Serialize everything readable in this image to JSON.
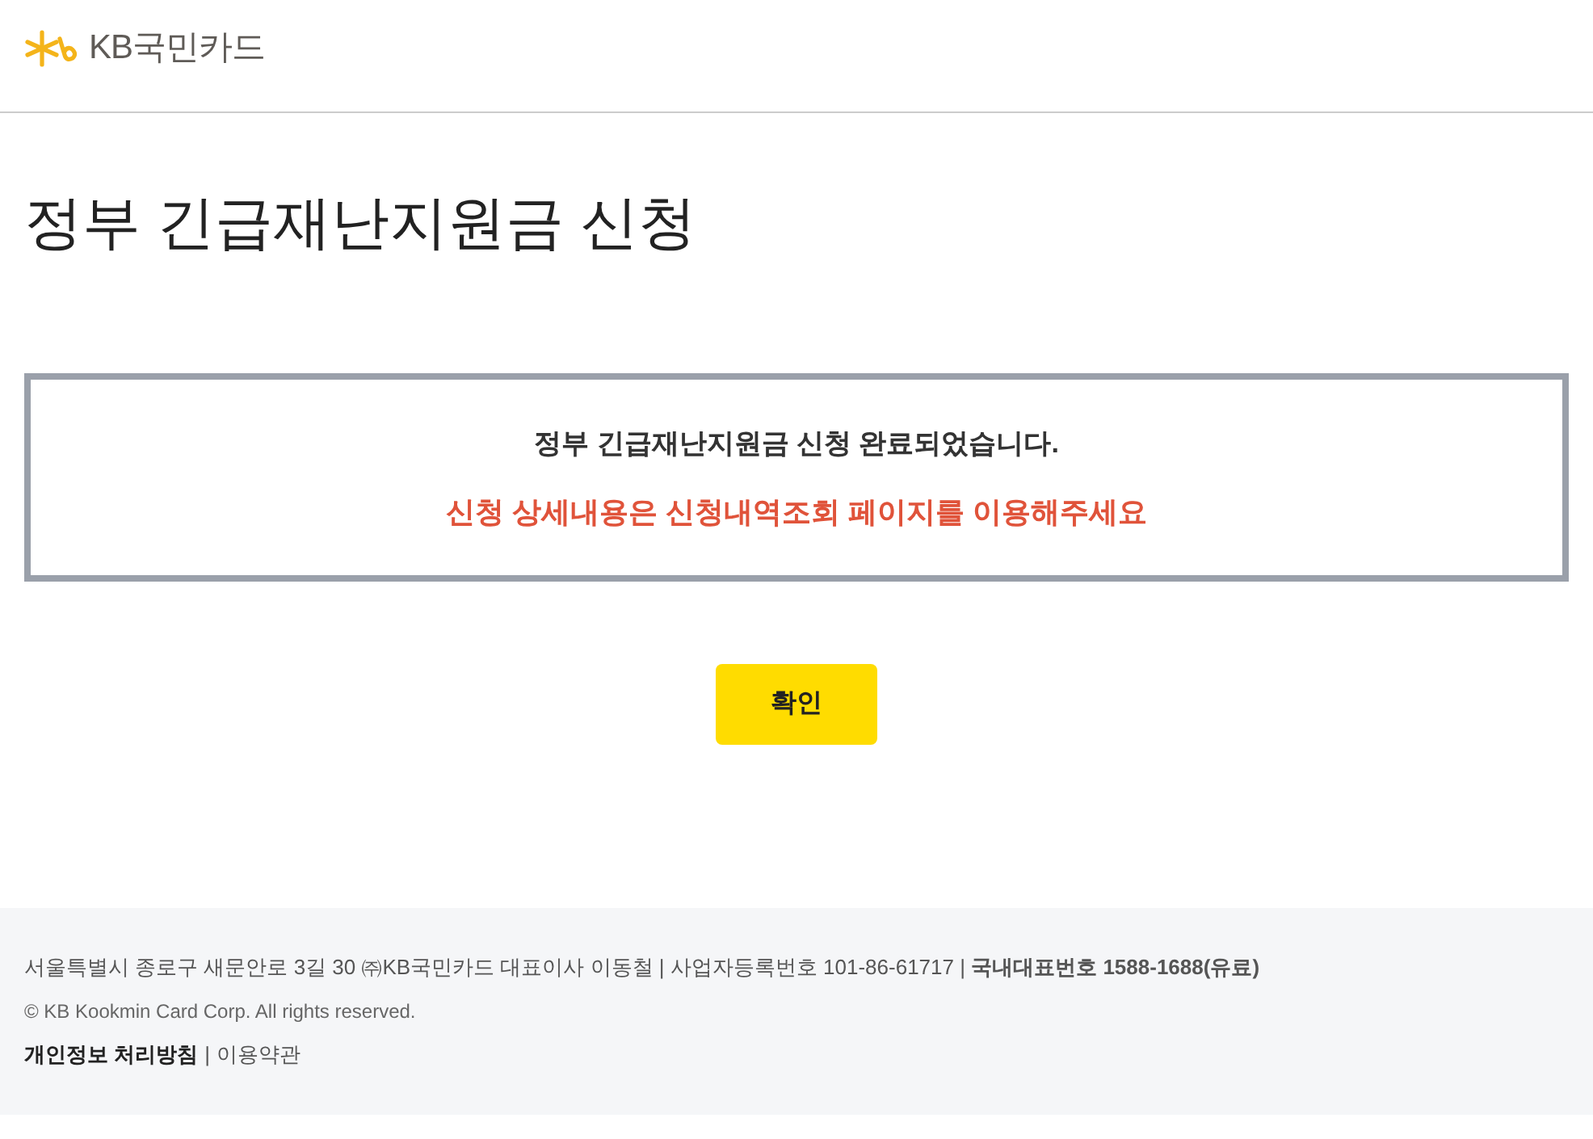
{
  "header": {
    "logo_text": "KB국민카드"
  },
  "page_title": "정부 긴급재난지원금 신청",
  "result_box": {
    "message": "정부 긴급재난지원금 신청 완료되었습니다.",
    "notice": "신청 상세내용은 신청내역조회 페이지를 이용해주세요"
  },
  "confirm_button": {
    "label": "확인"
  },
  "footer": {
    "address": "서울특별시 종로구 새문안로 3길 30 ㈜KB국민카드 대표이사 이동철 | 사업자등록번호 101-86-61717 | **국내대표번호 1588-1688(유료)**",
    "copyright": "© KB Kookmin Card Corp. All rights reserved.",
    "links": [
      {
        "label": "개인정보 처리방침",
        "emphasized": true
      },
      {
        "label": "이용약관",
        "emphasized": false
      }
    ],
    "separator": "|"
  }
}
